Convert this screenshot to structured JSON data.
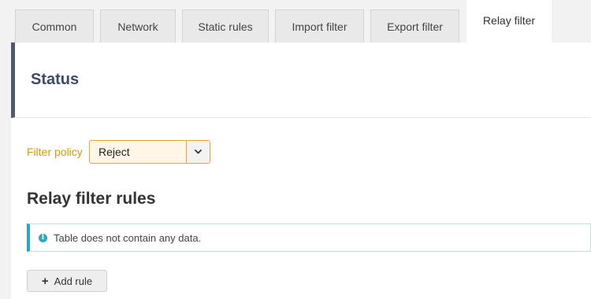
{
  "tabs": [
    {
      "label": "Common"
    },
    {
      "label": "Network"
    },
    {
      "label": "Static rules"
    },
    {
      "label": "Import filter"
    },
    {
      "label": "Export filter"
    },
    {
      "label": "Relay filter",
      "active": true
    }
  ],
  "status": {
    "title": "Status"
  },
  "filter_policy": {
    "label": "Filter policy",
    "value": "Reject"
  },
  "rules": {
    "title": "Relay filter rules",
    "empty_message": "Table does not contain any data.",
    "add_button": "Add rule"
  },
  "icons": {
    "info": "info-icon",
    "dropdown": "chevron-down-icon",
    "add": "plus-icon"
  },
  "colors": {
    "accent_orange": "#d99a00",
    "info_blue": "#2aa7c1",
    "status_title": "#3c4a63"
  }
}
